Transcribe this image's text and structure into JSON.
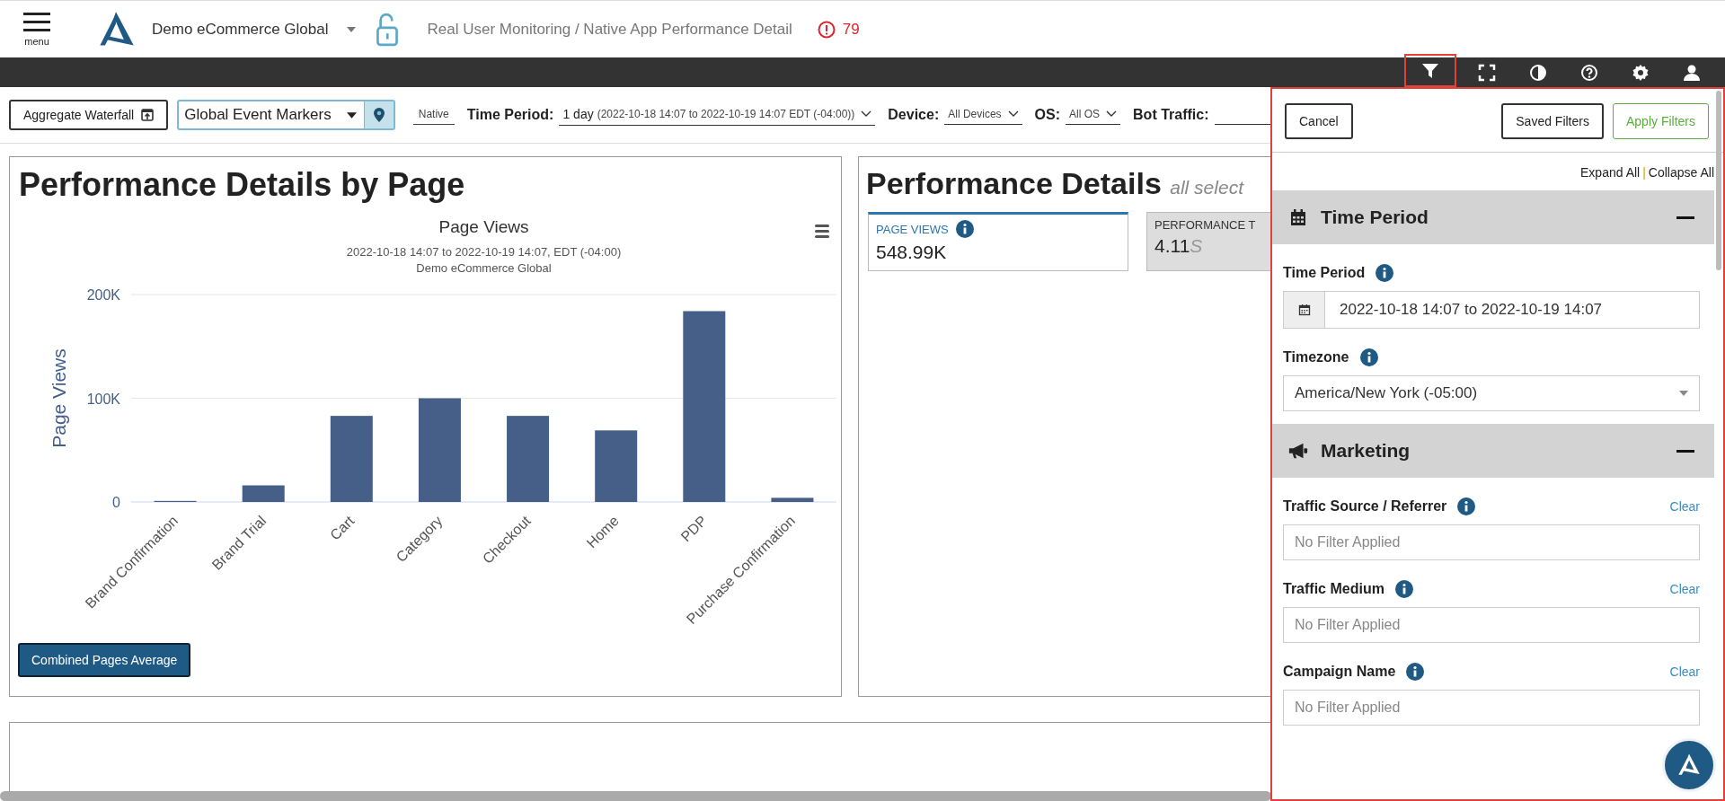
{
  "header": {
    "menu_label": "menu",
    "account": "Demo eCommerce Global",
    "breadcrumb": "Real User Monitoring / Native App Performance Detail",
    "alert_count": "79"
  },
  "toolbar_icons": [
    {
      "kind": "filter",
      "selected": true
    },
    {
      "kind": "fullscreen",
      "selected": false
    },
    {
      "kind": "contrast",
      "selected": false
    },
    {
      "kind": "help",
      "selected": false
    },
    {
      "kind": "settings",
      "selected": false
    },
    {
      "kind": "user",
      "selected": false
    }
  ],
  "controls": {
    "waterfall_button": "Aggregate Waterfall",
    "markers_select": "Global Event Markers",
    "native_tag": "Native",
    "filters": [
      {
        "label": "Time Period:",
        "value": "1 day",
        "detail": "(2022-10-18 14:07 to 2022-10-19 14:07 EDT (-04:00))"
      },
      {
        "label": "Device:",
        "value": "All Devices"
      },
      {
        "label": "OS:",
        "value": "All OS"
      },
      {
        "label": "Bot Traffic:"
      }
    ]
  },
  "page_card": {
    "title": "Performance Details by Page",
    "chart_subtitle": [
      "2022-10-18 14:07 to 2022-10-19 14:07, EDT (-04:00)",
      "Demo eCommerce Global"
    ],
    "button": "Combined Pages Average",
    "chart_data": {
      "type": "bar",
      "title": "Page Views",
      "ylabel": "Page Views",
      "categories": [
        "Brand Confirmation",
        "Brand Trial",
        "Cart",
        "Category",
        "Checkout",
        "Home",
        "PDP",
        "Purchase Confirmation"
      ],
      "series": [
        {
          "color": "#455f88",
          "values": [
            1000,
            16000,
            83000,
            100000,
            83000,
            69000,
            184000,
            4000
          ]
        }
      ],
      "ylim": [
        0,
        200000
      ],
      "yticks": [
        {
          "value": 0,
          "label": "0"
        },
        {
          "value": 100000,
          "label": "100K"
        },
        {
          "value": 200000,
          "label": "200K"
        }
      ]
    }
  },
  "details_card": {
    "title": "Performance Details",
    "subtitle": "all select",
    "metrics": [
      {
        "label": "PAGE VIEWS",
        "value": "548.99K",
        "selected": true,
        "info": true
      },
      {
        "label": "PERFORMANCE T",
        "value": "4.11",
        "unit": "S",
        "selected": false,
        "info": false
      }
    ]
  },
  "filter_panel": {
    "cancel": "Cancel",
    "saved": "Saved Filters",
    "apply": "Apply Filters",
    "expand_all": "Expand All",
    "separator": "|",
    "collapse_all": "Collapse All",
    "sections": [
      {
        "kind": "calendar",
        "title": "Time Period",
        "expanded": true,
        "fields": [
          {
            "kind": "date",
            "label": "Time Period",
            "value": "2022-10-18 14:07 to 2022-10-19 14:07"
          },
          {
            "kind": "select",
            "label": "Timezone",
            "value": "America/New York (-05:00)"
          }
        ]
      },
      {
        "kind": "megaphone",
        "title": "Marketing",
        "expanded": true,
        "fields": [
          {
            "kind": "text",
            "label": "Traffic Source / Referrer",
            "placeholder": "No Filter Applied",
            "clear": "Clear"
          },
          {
            "kind": "text",
            "label": "Traffic Medium",
            "placeholder": "No Filter Applied",
            "clear": "Clear"
          },
          {
            "kind": "text",
            "label": "Campaign Name",
            "placeholder": "No Filter Applied",
            "clear": "Clear"
          }
        ]
      }
    ]
  }
}
